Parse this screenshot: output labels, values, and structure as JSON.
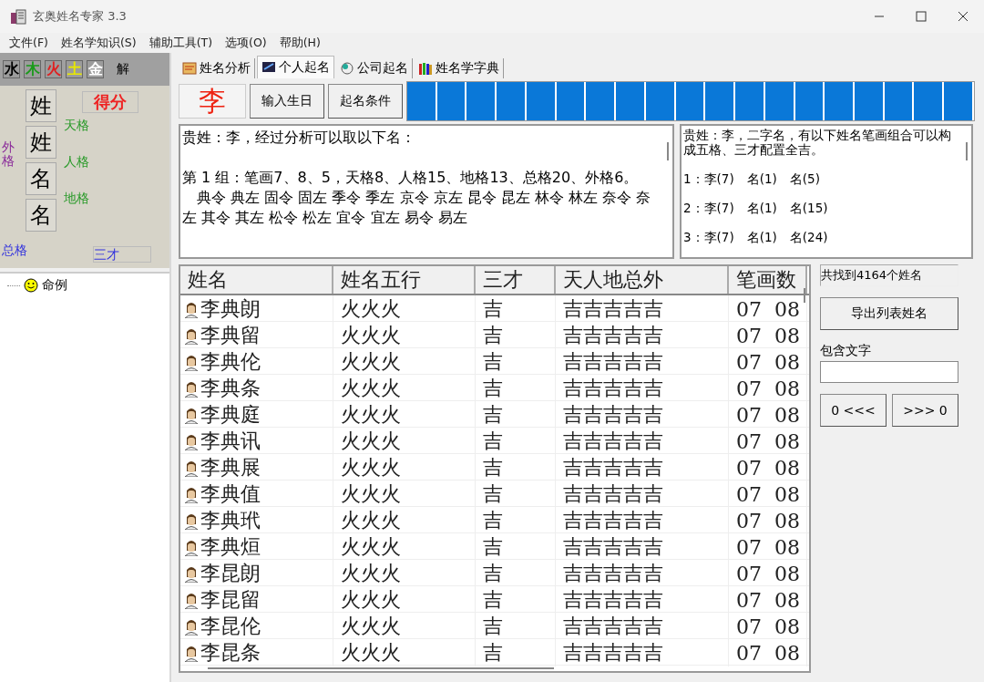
{
  "window": {
    "title": "玄奥姓名专家 3.3"
  },
  "menu": [
    "文件(F)",
    "姓名学知识(S)",
    "辅助工具(T)",
    "选项(O)",
    "帮助(H)"
  ],
  "elements": [
    {
      "label": "水",
      "color": "#000000"
    },
    {
      "label": "木",
      "color": "#1a9a1a"
    },
    {
      "label": "火",
      "color": "#e02020"
    },
    {
      "label": "土",
      "color": "#e8e800"
    },
    {
      "label": "金",
      "color": "#ffffff"
    }
  ],
  "explain_label": "解",
  "grid": {
    "chars": [
      "姓",
      "姓",
      "名",
      "名"
    ],
    "score": "得分",
    "tian": "天格",
    "ren": "人格",
    "di": "地格",
    "wai": "外格",
    "zong": "总格",
    "sancai": "三才"
  },
  "tree": [
    {
      "label": "命例"
    }
  ],
  "tabs": [
    {
      "label": "姓名分析",
      "selected": false
    },
    {
      "label": "个人起名",
      "selected": true
    },
    {
      "label": "公司起名",
      "selected": false
    },
    {
      "label": "姓名学字典",
      "selected": false
    }
  ],
  "surname": "李",
  "buttons": [
    "输入生日",
    "起名条件"
  ],
  "progress": {
    "level": 1
  },
  "analysis": [
    "贵姓：李，经过分析可以取以下名：",
    "第 1 组：笔画7、8、5，天格8、人格15、地格13、总格20、外格6。",
    "　典令 典左 固令 固左 季令 季左 京令 京左 昆令 昆左 林令 林左 奈令 奈左 其令 其左 松令 松左 宜令 宜左 易令 易左"
  ],
  "combos": {
    "intro": "贵姓：李，二字名，有以下姓名笔画组合可以构成五格、三才配置全吉。",
    "items": [
      "1：李(7)　名(1)　名(5)",
      "2：李(7)　名(1)　名(15)",
      "3：李(7)　名(1)　名(24)"
    ]
  },
  "table": {
    "columns": [
      "姓名",
      "姓名五行",
      "三才",
      "天人地总外",
      "笔画数"
    ],
    "rows": [
      [
        "李典朗",
        "火火火",
        "吉",
        "吉吉吉吉吉",
        "07  08"
      ],
      [
        "李典留",
        "火火火",
        "吉",
        "吉吉吉吉吉",
        "07  08"
      ],
      [
        "李典伦",
        "火火火",
        "吉",
        "吉吉吉吉吉",
        "07  08"
      ],
      [
        "李典条",
        "火火火",
        "吉",
        "吉吉吉吉吉",
        "07  08"
      ],
      [
        "李典庭",
        "火火火",
        "吉",
        "吉吉吉吉吉",
        "07  08"
      ],
      [
        "李典讯",
        "火火火",
        "吉",
        "吉吉吉吉吉",
        "07  08"
      ],
      [
        "李典展",
        "火火火",
        "吉",
        "吉吉吉吉吉",
        "07  08"
      ],
      [
        "李典值",
        "火火火",
        "吉",
        "吉吉吉吉吉",
        "07  08"
      ],
      [
        "李典玳",
        "火火火",
        "吉",
        "吉吉吉吉吉",
        "07  08"
      ],
      [
        "李典烜",
        "火火火",
        "吉",
        "吉吉吉吉吉",
        "07  08"
      ],
      [
        "李昆朗",
        "火火火",
        "吉",
        "吉吉吉吉吉",
        "07  08"
      ],
      [
        "李昆留",
        "火火火",
        "吉",
        "吉吉吉吉吉",
        "07  08"
      ],
      [
        "李昆伦",
        "火火火",
        "吉",
        "吉吉吉吉吉",
        "07  08"
      ],
      [
        "李昆条",
        "火火火",
        "吉",
        "吉吉吉吉吉",
        "07  08"
      ]
    ]
  },
  "side": {
    "found": "共找到4164个姓名",
    "export": "导出列表姓名",
    "contains_label": "包含文字",
    "prev": "0 <<<",
    "next": ">>> 0"
  }
}
